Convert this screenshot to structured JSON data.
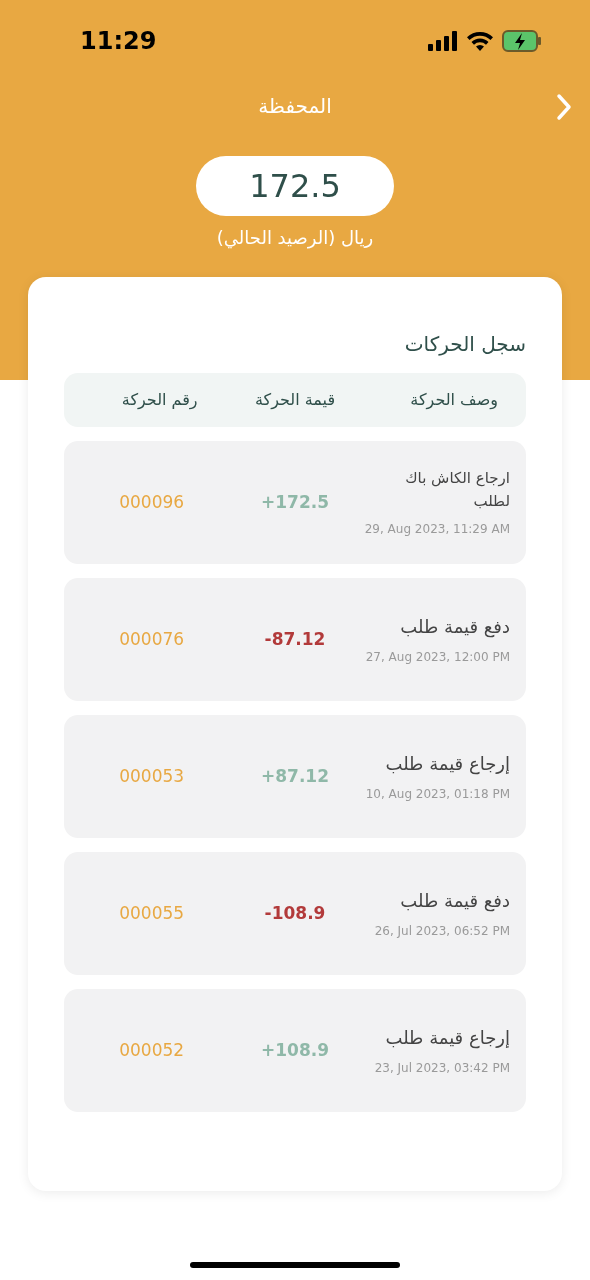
{
  "status_bar": {
    "time": "11:29"
  },
  "header": {
    "title": "المحفظة"
  },
  "balance": {
    "amount": "172.5",
    "caption": "ريال (الرصيد الحالي)"
  },
  "history": {
    "title": "سجل الحركات",
    "columns": [
      "وصف الحركة",
      "قيمة الحركة",
      "رقم الحركة"
    ],
    "rows": [
      {
        "description": "ارجاع الكاش باك لطلب",
        "date": "29, Aug 2023, 11:29 AM",
        "amount": "+172.5",
        "kind": "credit",
        "number": "000096"
      },
      {
        "description": "دفع قيمة طلب",
        "date": "27, Aug 2023, 12:00 PM",
        "amount": "-87.12",
        "kind": "debit",
        "number": "000076"
      },
      {
        "description": "إرجاع قيمة طلب",
        "date": "10, Aug 2023, 01:18 PM",
        "amount": "+87.12",
        "kind": "credit",
        "number": "000053"
      },
      {
        "description": "دفع قيمة طلب",
        "date": "26, Jul 2023, 06:52 PM",
        "amount": "-108.9",
        "kind": "debit",
        "number": "000055"
      },
      {
        "description": "إرجاع قيمة طلب",
        "date": "23, Jul 2023, 03:42 PM",
        "amount": "+108.9",
        "kind": "credit",
        "number": "000052"
      }
    ]
  }
}
